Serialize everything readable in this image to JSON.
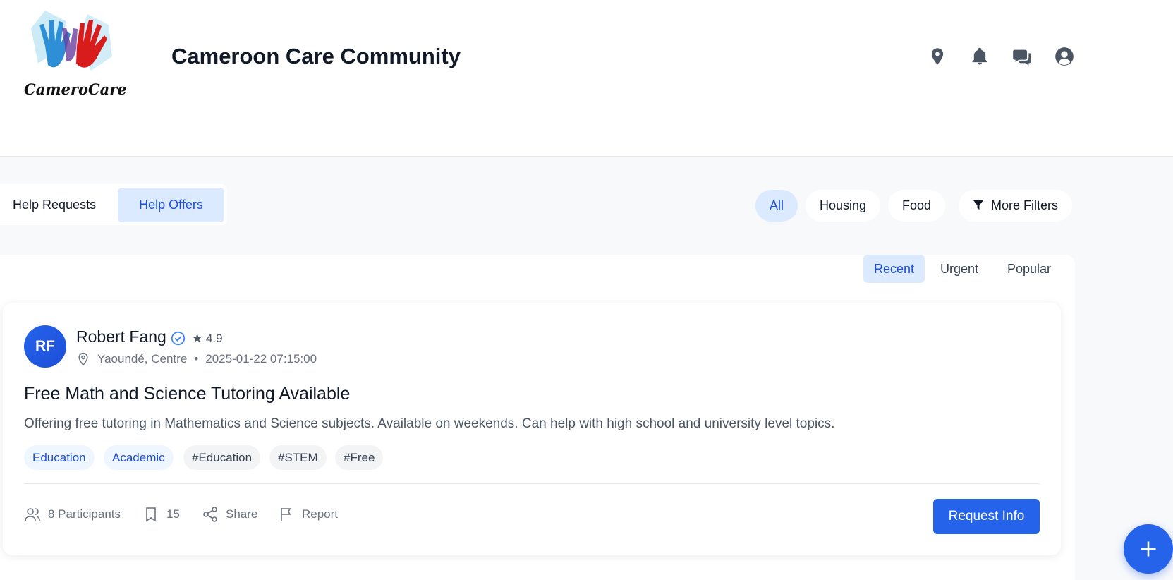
{
  "header": {
    "logo_text": "CameroCare",
    "title": "Cameroon Care Community",
    "icons": [
      "map-pin-icon",
      "bell-icon",
      "chat-icon",
      "user-icon"
    ]
  },
  "type_tabs": [
    {
      "label": "Help Requests",
      "active": false
    },
    {
      "label": "Help Offers",
      "active": true
    }
  ],
  "category_filters": [
    {
      "label": "All",
      "active": true
    },
    {
      "label": "Housing",
      "active": false
    },
    {
      "label": "Food",
      "active": false
    },
    {
      "label": "More Filters",
      "active": false,
      "icon": "filter-icon"
    }
  ],
  "sort_tabs": [
    {
      "label": "Recent",
      "active": true
    },
    {
      "label": "Urgent",
      "active": false
    },
    {
      "label": "Popular",
      "active": false
    }
  ],
  "post": {
    "avatar_initials": "RF",
    "author": "Robert Fang",
    "verified": true,
    "rating": "★ 4.9",
    "location": "Yaoundé, Centre",
    "separator": "•",
    "timestamp": "2025-01-22 07:15:00",
    "title": "Free Math and Science Tutoring Available",
    "body": "Offering free tutoring in Mathematics and Science subjects. Available on weekends. Can help with high school and university level topics.",
    "category_tags": [
      "Education",
      "Academic"
    ],
    "hashtags": [
      "#Education",
      "#STEM",
      "#Free"
    ],
    "participants": "8 Participants",
    "bookmarks": "15",
    "share_label": "Share",
    "report_label": "Report",
    "cta_label": "Request Info"
  },
  "colors": {
    "accent": "#2563eb",
    "accent_light": "#dbeafe",
    "background": "#f8f9fb"
  }
}
